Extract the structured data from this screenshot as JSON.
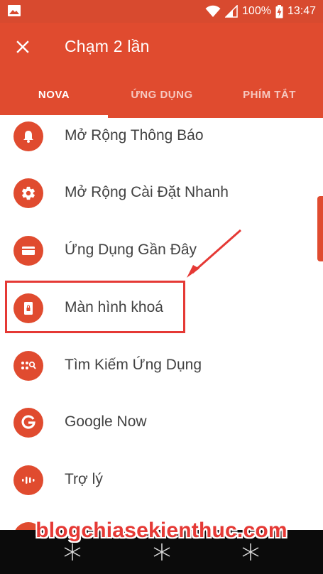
{
  "status_bar": {
    "battery": "100%",
    "time": "13:47"
  },
  "header": {
    "title": "Chạm 2 lần"
  },
  "tabs": [
    {
      "label": "NOVA",
      "active": true
    },
    {
      "label": "ỨNG DỤNG",
      "active": false
    },
    {
      "label": "PHÍM TẮT",
      "active": false
    }
  ],
  "items": [
    {
      "label": "Mở Rộng Thông Báo",
      "icon": "bell-icon"
    },
    {
      "label": "Mở Rộng Cài Đặt Nhanh",
      "icon": "gear-icon"
    },
    {
      "label": "Ứng Dụng Gần Đây",
      "icon": "recent-apps-icon"
    },
    {
      "label": "Màn hình khoá",
      "icon": "lock-screen-icon",
      "highlighted": true
    },
    {
      "label": "Tìm Kiếm Ứng Dụng",
      "icon": "app-search-icon"
    },
    {
      "label": "Google Now",
      "icon": "google-icon"
    },
    {
      "label": "Trợ lý",
      "icon": "assistant-icon"
    }
  ],
  "watermark": "blogchiasekienthuc.com",
  "colors": {
    "primary": "#e04b2f",
    "status_bar": "#d84a2f",
    "highlight": "#e53935",
    "text": "#424242"
  }
}
